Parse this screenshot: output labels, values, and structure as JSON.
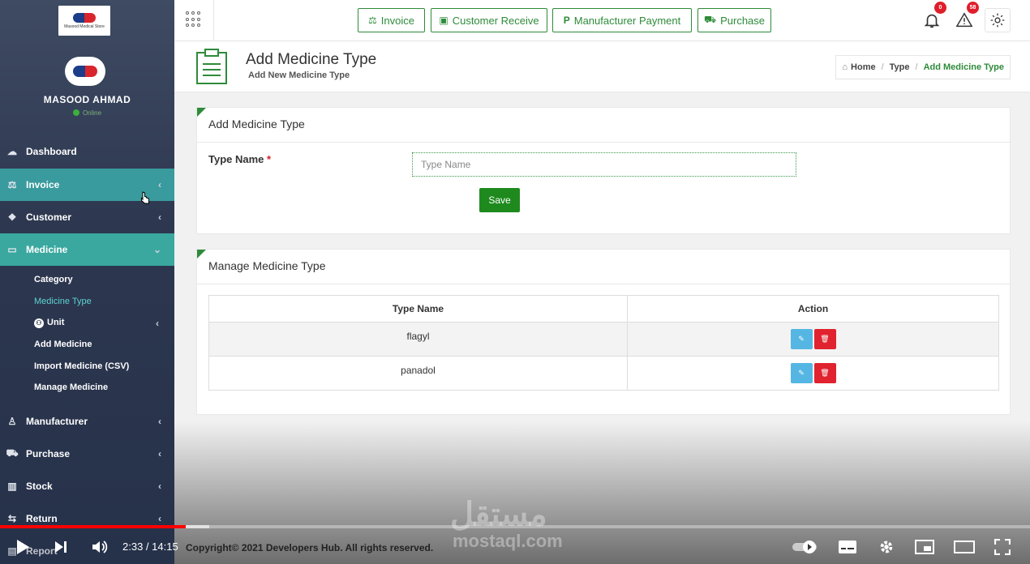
{
  "sidebar": {
    "logo_text": "Masood Medical Store",
    "user_name": "MASOOD AHMAD",
    "user_status": "Online",
    "items": [
      {
        "label": "Dashboard",
        "icon": "dashboard-icon"
      },
      {
        "label": "Invoice",
        "icon": "scale-icon"
      },
      {
        "label": "Customer",
        "icon": "handshake-icon"
      },
      {
        "label": "Medicine",
        "icon": "bag-icon"
      },
      {
        "label": "Manufacturer",
        "icon": "user-icon"
      },
      {
        "label": "Purchase",
        "icon": "cart-icon"
      },
      {
        "label": "Stock",
        "icon": "bar-chart-icon"
      },
      {
        "label": "Return",
        "icon": "return-icon"
      },
      {
        "label": "Report",
        "icon": "report-icon"
      }
    ],
    "submenu": [
      "Category",
      "Medicine Type",
      "Unit",
      "Add Medicine",
      "Import Medicine (CSV)",
      "Manage Medicine"
    ]
  },
  "topbar": {
    "buttons": [
      "Invoice",
      "Customer Receive",
      "Manufacturer Payment",
      "Purchase"
    ],
    "notification_count": "0",
    "alert_count": "58"
  },
  "page": {
    "title": "Add Medicine Type",
    "subtitle": "Add New Medicine Type",
    "breadcrumb": [
      "Home",
      "Type",
      "Add Medicine Type"
    ]
  },
  "form": {
    "panel_title": "Add Medicine Type",
    "label": "Type Name",
    "required_mark": "*",
    "placeholder": "Type Name",
    "save_label": "Save"
  },
  "manage": {
    "panel_title": "Manage Medicine Type",
    "columns": [
      "Type Name",
      "Action"
    ],
    "rows": [
      "flagyl",
      "panadol"
    ]
  },
  "footer": {
    "copyright": "Copyright© 2021 Developers Hub. All rights reserved."
  },
  "video": {
    "time": "2:33 / 14:15",
    "progress": 0.18,
    "watermark": "مستقل",
    "watermark_sub": "mostaql.com"
  }
}
